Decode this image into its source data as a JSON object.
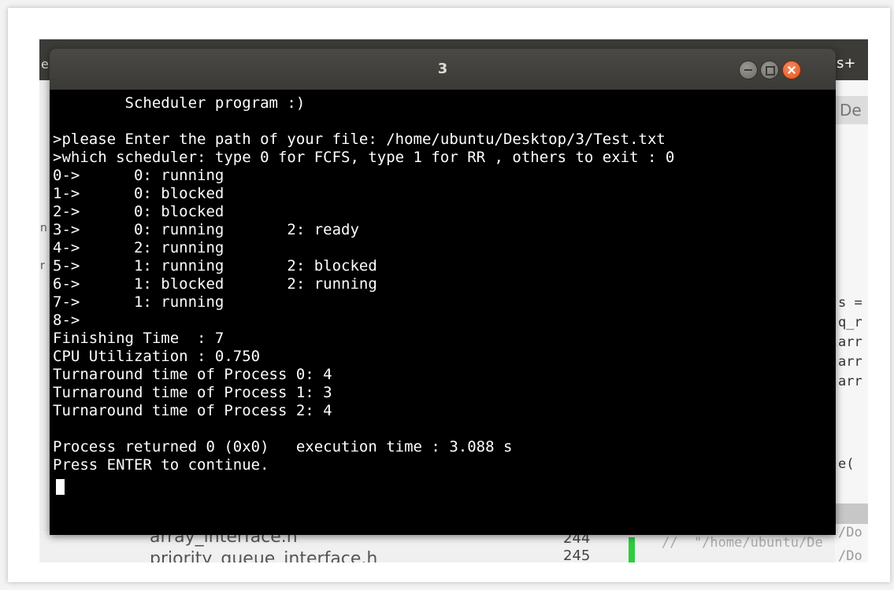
{
  "window": {
    "title": "3"
  },
  "background_app": {
    "top_right_fragment": "s+",
    "left_fragment": "e",
    "right_tab_fragment": "De",
    "right_code_fragments": [
      "s =",
      "q_r",
      "arr",
      "arr",
      "arr",
      "e("
    ],
    "right_path_fragments": [
      "/Do",
      "/Do",
      "/Do"
    ],
    "left_strip_fragments": [
      "n",
      "r"
    ],
    "bottom_files": [
      "array_interface.h",
      "priority_queue_interface.h"
    ],
    "bottom_line_numbers": [
      "244",
      "245"
    ],
    "bottom_comment": "//  \"/home/ubuntu/De"
  },
  "terminal": {
    "lines": [
      "        Scheduler program :)",
      "",
      ">please Enter the path of your file: /home/ubuntu/Desktop/3/Test.txt",
      ">which scheduler: type 0 for FCFS, type 1 for RR , others to exit : 0",
      "0->      0: running",
      "1->      0: blocked",
      "2->      0: blocked",
      "3->      0: running       2: ready",
      "4->      2: running",
      "5->      1: running       2: blocked",
      "6->      1: blocked       2: running",
      "7->      1: running",
      "8->",
      "Finishing Time  : 7",
      "CPU Utilization : 0.750",
      "Turnaround time of Process 0: 4",
      "Turnaround time of Process 1: 3",
      "Turnaround time of Process 2: 4",
      "",
      "Process returned 0 (0x0)   execution time : 3.088 s",
      "Press ENTER to continue."
    ]
  }
}
